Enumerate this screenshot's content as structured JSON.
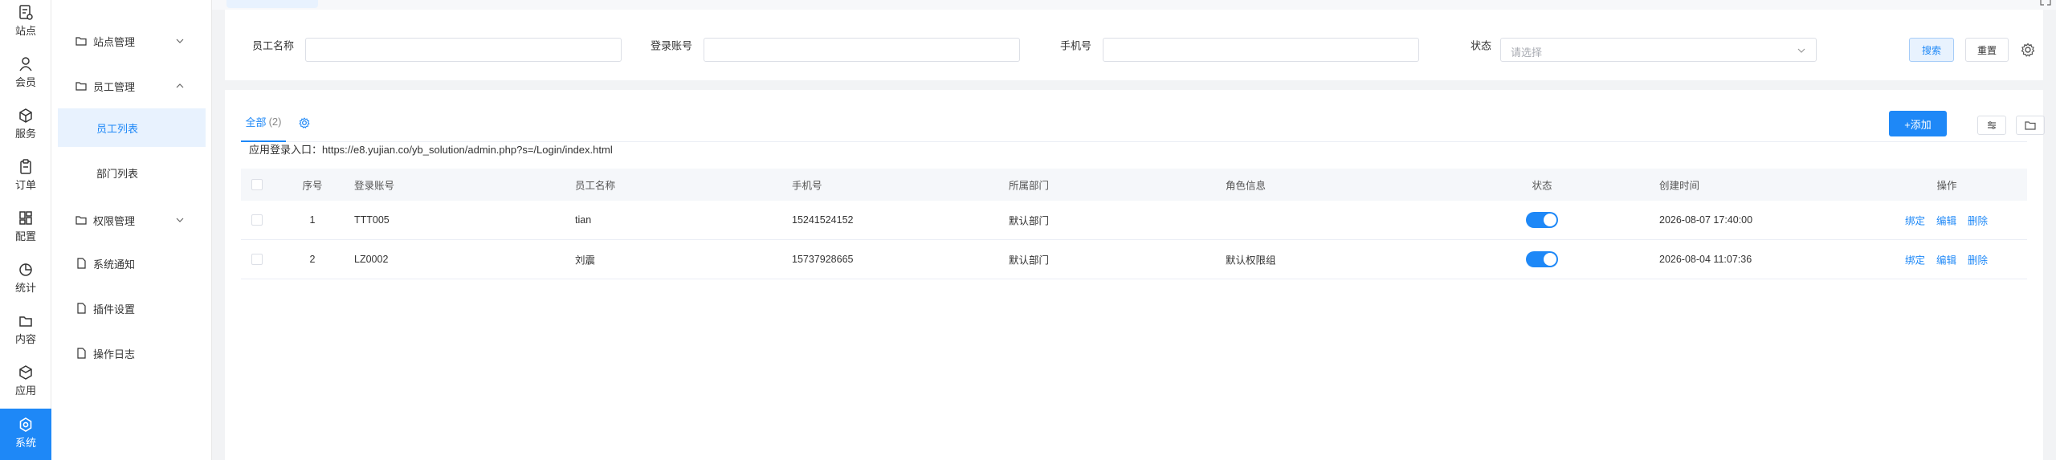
{
  "rail": {
    "items": [
      {
        "label": "站点",
        "icon": "site-icon"
      },
      {
        "label": "会员",
        "icon": "user-icon"
      },
      {
        "label": "服务",
        "icon": "cube-icon"
      },
      {
        "label": "订单",
        "icon": "clipboard-icon"
      },
      {
        "label": "配置",
        "icon": "grid-icon"
      },
      {
        "label": "统计",
        "icon": "pie-icon"
      },
      {
        "label": "内容",
        "icon": "folder-icon"
      },
      {
        "label": "应用",
        "icon": "box-icon"
      },
      {
        "label": "系统",
        "icon": "system-icon",
        "active": true
      }
    ]
  },
  "subnav": {
    "items": [
      {
        "label": "站点管理",
        "icon": "folder-icon",
        "expandable": true,
        "expanded": false
      },
      {
        "label": "员工管理",
        "icon": "folder-icon",
        "expandable": true,
        "expanded": true
      },
      {
        "label": "员工列表",
        "sub": true,
        "selected": true
      },
      {
        "label": "部门列表",
        "sub": true
      },
      {
        "label": "权限管理",
        "icon": "folder-icon",
        "expandable": true,
        "expanded": false
      },
      {
        "label": "系统通知",
        "icon": "file-icon"
      },
      {
        "label": "插件设置",
        "icon": "file-icon"
      },
      {
        "label": "操作日志",
        "icon": "file-icon"
      }
    ]
  },
  "search": {
    "name_label": "员工名称",
    "account_label": "登录账号",
    "phone_label": "手机号",
    "status_label": "状态",
    "status_placeholder": "请选择",
    "search_button": "搜索",
    "reset_button": "重置"
  },
  "list": {
    "tab_all": "全部",
    "tab_count": "(2)",
    "add_button": "+添加",
    "login_entry": "应用登录入口：https://e8.yujian.co/yb_solution/admin.php?s=/Login/index.html",
    "columns": [
      "序号",
      "登录账号",
      "员工名称",
      "手机号",
      "所属部门",
      "角色信息",
      "状态",
      "创建时间",
      "操作"
    ],
    "rows": [
      {
        "no": "1",
        "account": "TTT005",
        "name": "tian",
        "phone": "15241524152",
        "dept": "默认部门",
        "role": "",
        "status_on": true,
        "created": "2026-08-07 17:40:00"
      },
      {
        "no": "2",
        "account": "LZ0002",
        "name": "刘震",
        "phone": "15737928665",
        "dept": "默认部门",
        "role": "默认权限组",
        "status_on": true,
        "created": "2026-08-04 11:07:36"
      }
    ],
    "actions": {
      "bind": "绑定",
      "edit": "编辑",
      "delete": "删除"
    }
  },
  "colors": {
    "accent": "#1e88f7",
    "accent_light": "#e8f2fe"
  }
}
